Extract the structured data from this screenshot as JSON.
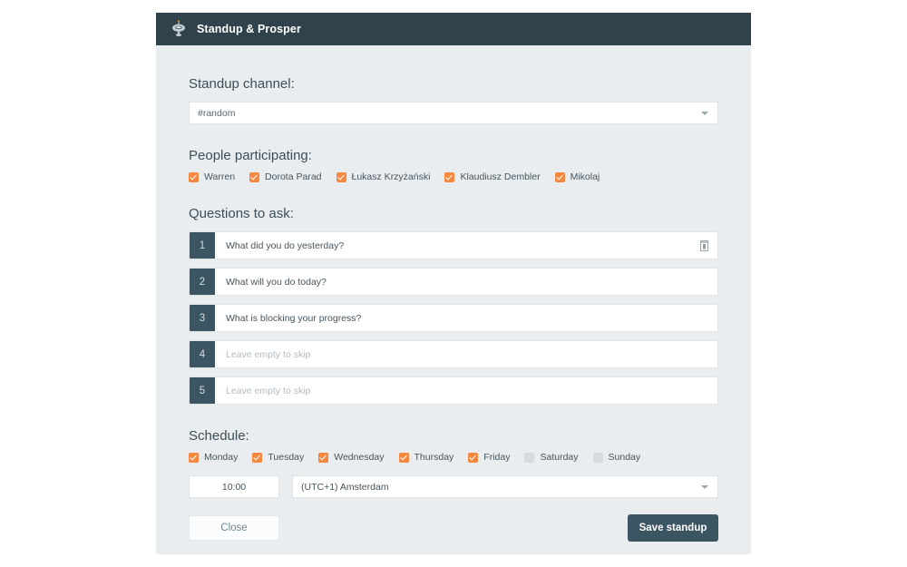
{
  "header": {
    "title": "Standup & Prosper",
    "icon": "ufo-icon",
    "bg_color": "#30434c"
  },
  "channel": {
    "label": "Standup channel:",
    "value": "#random",
    "caret_icon": "chevron-down-icon"
  },
  "people": {
    "label": "People participating:",
    "items": [
      {
        "name": "Warren",
        "checked": true
      },
      {
        "name": "Dorota Parad",
        "checked": true
      },
      {
        "name": "Łukasz Krzyżański",
        "checked": true
      },
      {
        "name": "Klaudiusz Dembler",
        "checked": true
      },
      {
        "name": "Mikolaj",
        "checked": true
      }
    ]
  },
  "questions": {
    "label": "Questions to ask:",
    "placeholder": "Leave empty to skip",
    "rows": [
      {
        "num": "1",
        "value": "What did you do yesterday?",
        "has_delete": true
      },
      {
        "num": "2",
        "value": "What will you do today?",
        "has_delete": false
      },
      {
        "num": "3",
        "value": "What is blocking your progress?",
        "has_delete": false
      },
      {
        "num": "4",
        "value": "",
        "has_delete": false
      },
      {
        "num": "5",
        "value": "",
        "has_delete": false
      }
    ],
    "delete_icon": "trash-icon"
  },
  "schedule": {
    "label": "Schedule:",
    "days": [
      {
        "name": "Monday",
        "checked": true
      },
      {
        "name": "Tuesday",
        "checked": true
      },
      {
        "name": "Wednesday",
        "checked": true
      },
      {
        "name": "Thursday",
        "checked": true
      },
      {
        "name": "Friday",
        "checked": true
      },
      {
        "name": "Saturday",
        "checked": false
      },
      {
        "name": "Sunday",
        "checked": false
      }
    ],
    "time": "10:00",
    "timezone": "(UTC+1) Amsterdam",
    "caret_icon": "chevron-down-icon"
  },
  "footer": {
    "close_label": "Close",
    "save_label": "Save standup"
  },
  "colors": {
    "accent_orange": "#f5873f",
    "dark_slate": "#3c5562",
    "header_bg": "#30434c",
    "card_bg": "#e9edf0",
    "unchecked_grey": "#d6dbdf"
  }
}
